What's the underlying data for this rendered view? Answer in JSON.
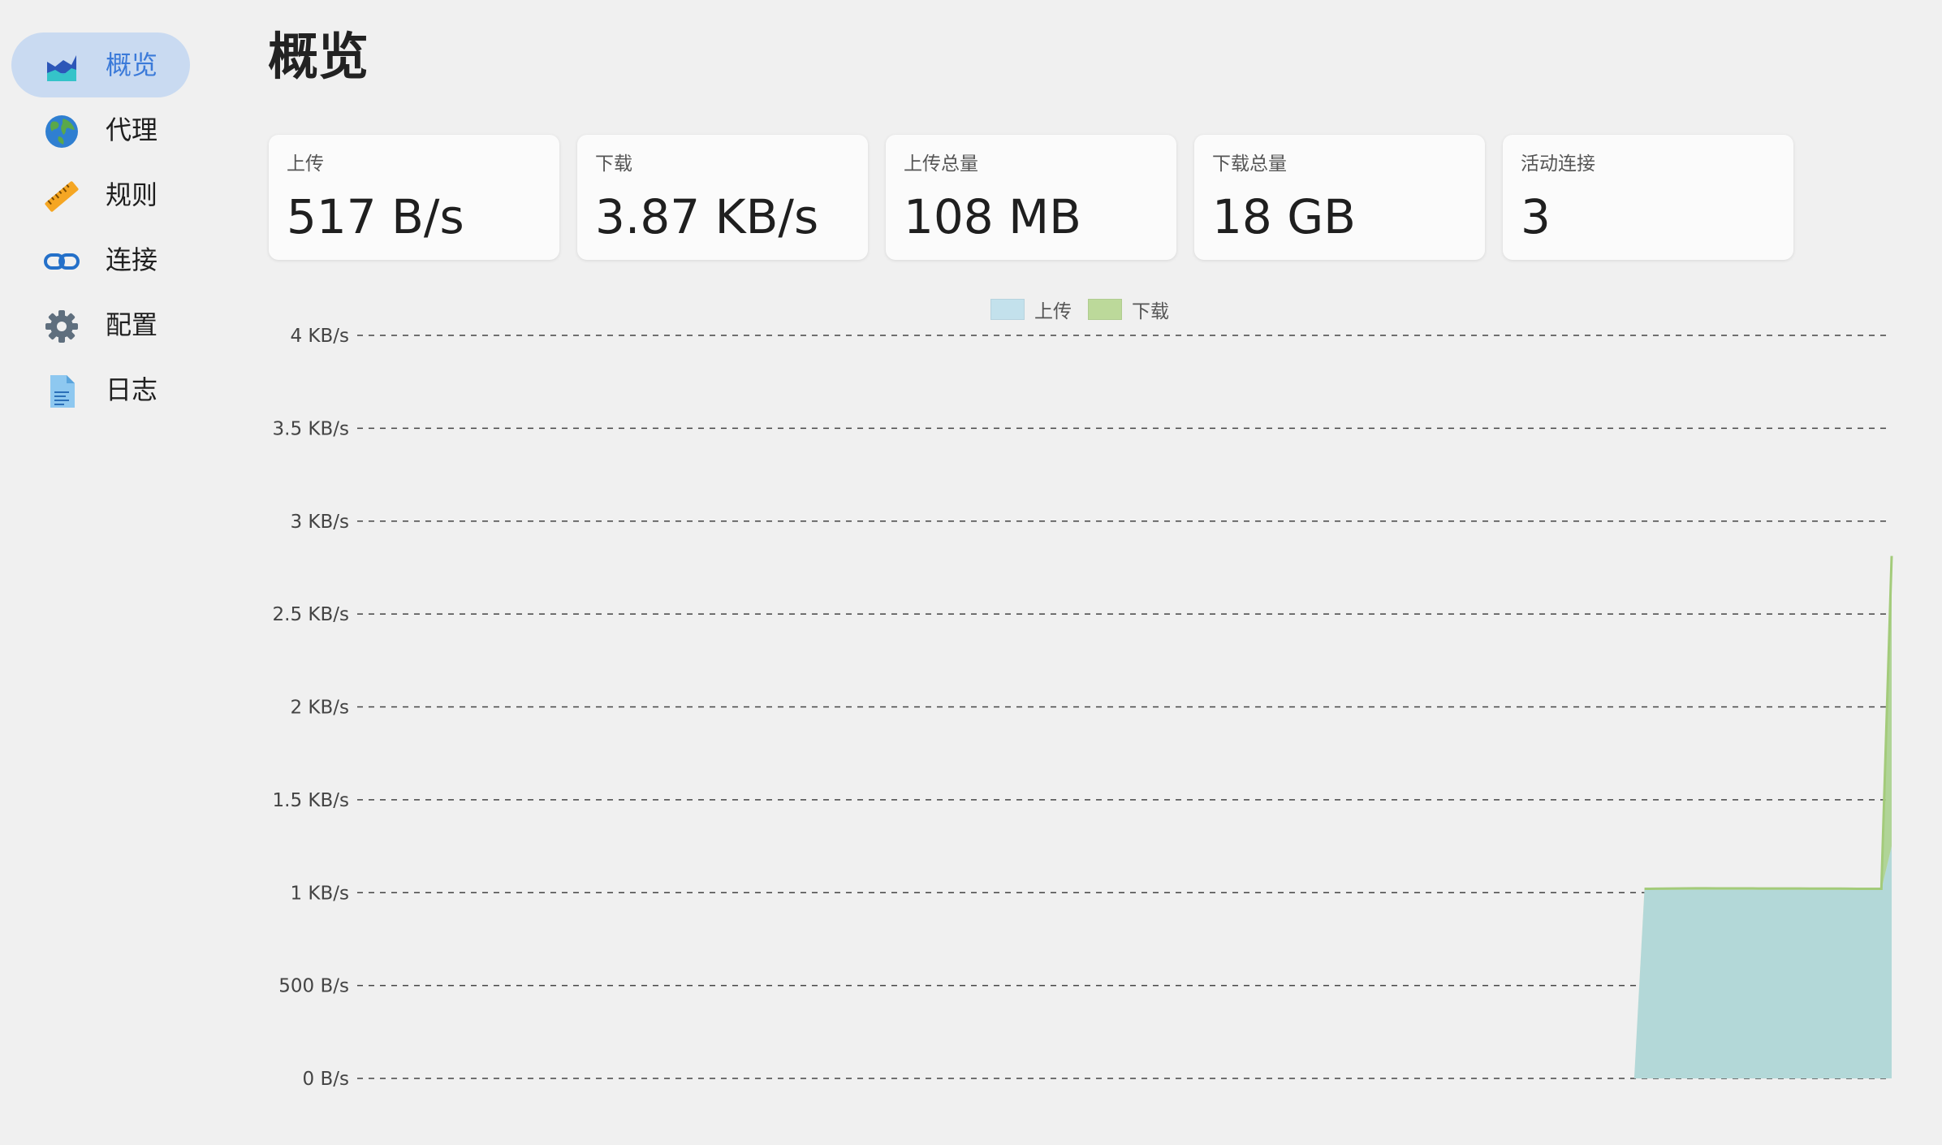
{
  "sidebar": {
    "items": [
      {
        "label": "概览",
        "icon": "chart-icon",
        "active": true
      },
      {
        "label": "代理",
        "icon": "globe-icon",
        "active": false
      },
      {
        "label": "规则",
        "icon": "ruler-icon",
        "active": false
      },
      {
        "label": "连接",
        "icon": "link-icon",
        "active": false
      },
      {
        "label": "配置",
        "icon": "gear-icon",
        "active": false
      },
      {
        "label": "日志",
        "icon": "document-icon",
        "active": false
      }
    ]
  },
  "main": {
    "title": "概览",
    "stats": [
      {
        "label": "上传",
        "value": "517 B/s"
      },
      {
        "label": "下载",
        "value": "3.87 KB/s"
      },
      {
        "label": "上传总量",
        "value": "108 MB"
      },
      {
        "label": "下载总量",
        "value": "18 GB"
      },
      {
        "label": "活动连接",
        "value": "3"
      }
    ]
  },
  "colors": {
    "accent": "#3b7ad9",
    "active_nav_bg": "#c9daf1",
    "upload_fill": "#b3d8e6",
    "download_fill": "#a8d08d",
    "download_line": "#a3cb7a"
  },
  "chart_data": {
    "type": "area",
    "legend": [
      {
        "name": "上传",
        "color": "#c3e1ec"
      },
      {
        "name": "下载",
        "color": "#bcd99a"
      }
    ],
    "legend_placement": "top-center",
    "grid": true,
    "y_unit": "bytes/s",
    "ylim": [
      0,
      4096
    ],
    "yticks": [
      "0 B/s",
      "500 B/s",
      "1 KB/s",
      "1.5 KB/s",
      "2 KB/s",
      "2.5 KB/s",
      "3 KB/s",
      "3.5 KB/s",
      "4 KB/s"
    ],
    "ytick_values": [
      0,
      512,
      1024,
      1536,
      2048,
      2560,
      3072,
      3584,
      4096
    ],
    "n_points": 150,
    "series": [
      {
        "name": "上传",
        "points": [
          [
            0,
            0
          ],
          [
            124,
            0
          ],
          [
            125,
            1040
          ],
          [
            145,
            1040
          ],
          [
            146,
            1040
          ],
          [
            147,
            1040
          ],
          [
            148,
            1040
          ],
          [
            149,
            1280
          ]
        ]
      },
      {
        "name": "下载",
        "points": [
          [
            0,
            0
          ],
          [
            124,
            0
          ],
          [
            125,
            5
          ],
          [
            130,
            8
          ],
          [
            145,
            6
          ],
          [
            146,
            5
          ],
          [
            147,
            5
          ],
          [
            148,
            5
          ],
          [
            149,
            1600
          ]
        ]
      }
    ]
  }
}
